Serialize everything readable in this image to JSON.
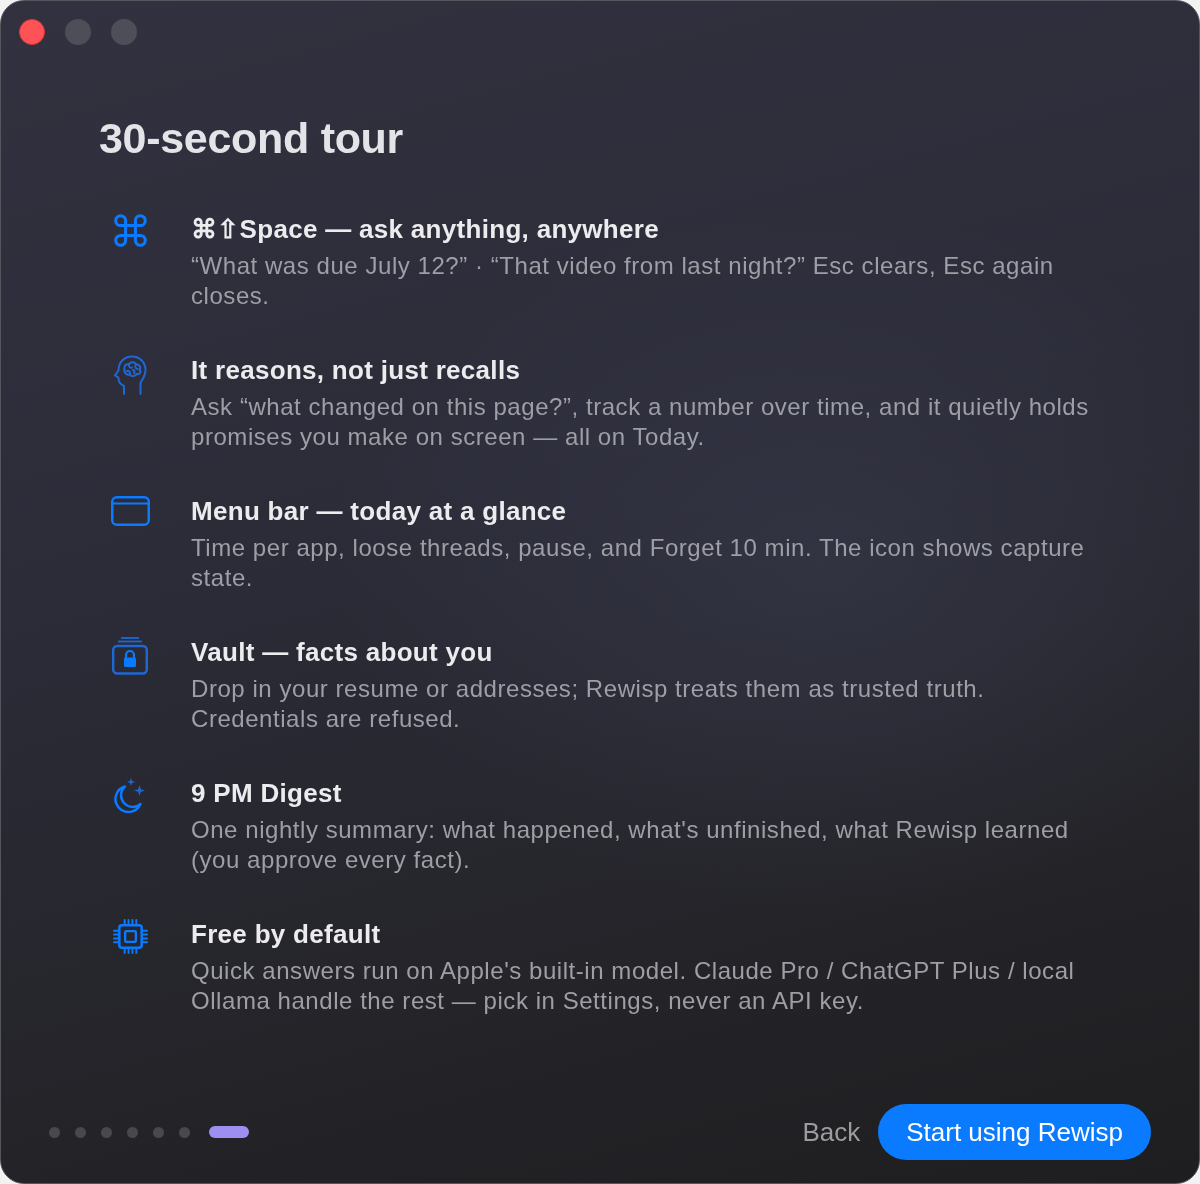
{
  "window": {
    "controls": [
      {
        "kind": "close",
        "disabled": false
      },
      {
        "kind": "minimize",
        "disabled": true
      },
      {
        "kind": "zoom",
        "disabled": true
      }
    ]
  },
  "title": "30-second tour",
  "features": [
    {
      "kind": "command",
      "title": "⌘⇧Space — ask anything, anywhere",
      "description": "“What was due July 12?” · “That video from last night?” Esc clears, Esc again closes."
    },
    {
      "kind": "brain",
      "title": "It reasons, not just recalls",
      "description": "Ask “what changed on this page?”, track a number over time, and it quietly holds promises you make on screen — all on Today."
    },
    {
      "kind": "window",
      "title": "Menu bar — today at a glance",
      "description": "Time per app, loose threads, pause, and Forget 10 min. The icon shows capture state."
    },
    {
      "kind": "vault",
      "title": "Vault — facts about you",
      "description": "Drop in your resume or addresses; Rewisp treats them as trusted truth. Credentials are refused."
    },
    {
      "kind": "moon",
      "title": "9 PM Digest",
      "description": "One nightly summary: what happened, what's unfinished, what Rewisp learned (you approve every fact)."
    },
    {
      "kind": "chip",
      "title": "Free by default",
      "description": "Quick answers run on Apple's built-in model. Claude Pro / ChatGPT Plus / local Ollama handle the rest — pick in Settings, never an API key."
    }
  ],
  "page_dots": [
    {
      "selected": false
    },
    {
      "selected": false
    },
    {
      "selected": false
    },
    {
      "selected": false
    },
    {
      "selected": false
    },
    {
      "selected": false
    },
    {
      "selected": true
    }
  ],
  "buttons": {
    "back": "Back",
    "primary": "Start using Rewisp"
  }
}
